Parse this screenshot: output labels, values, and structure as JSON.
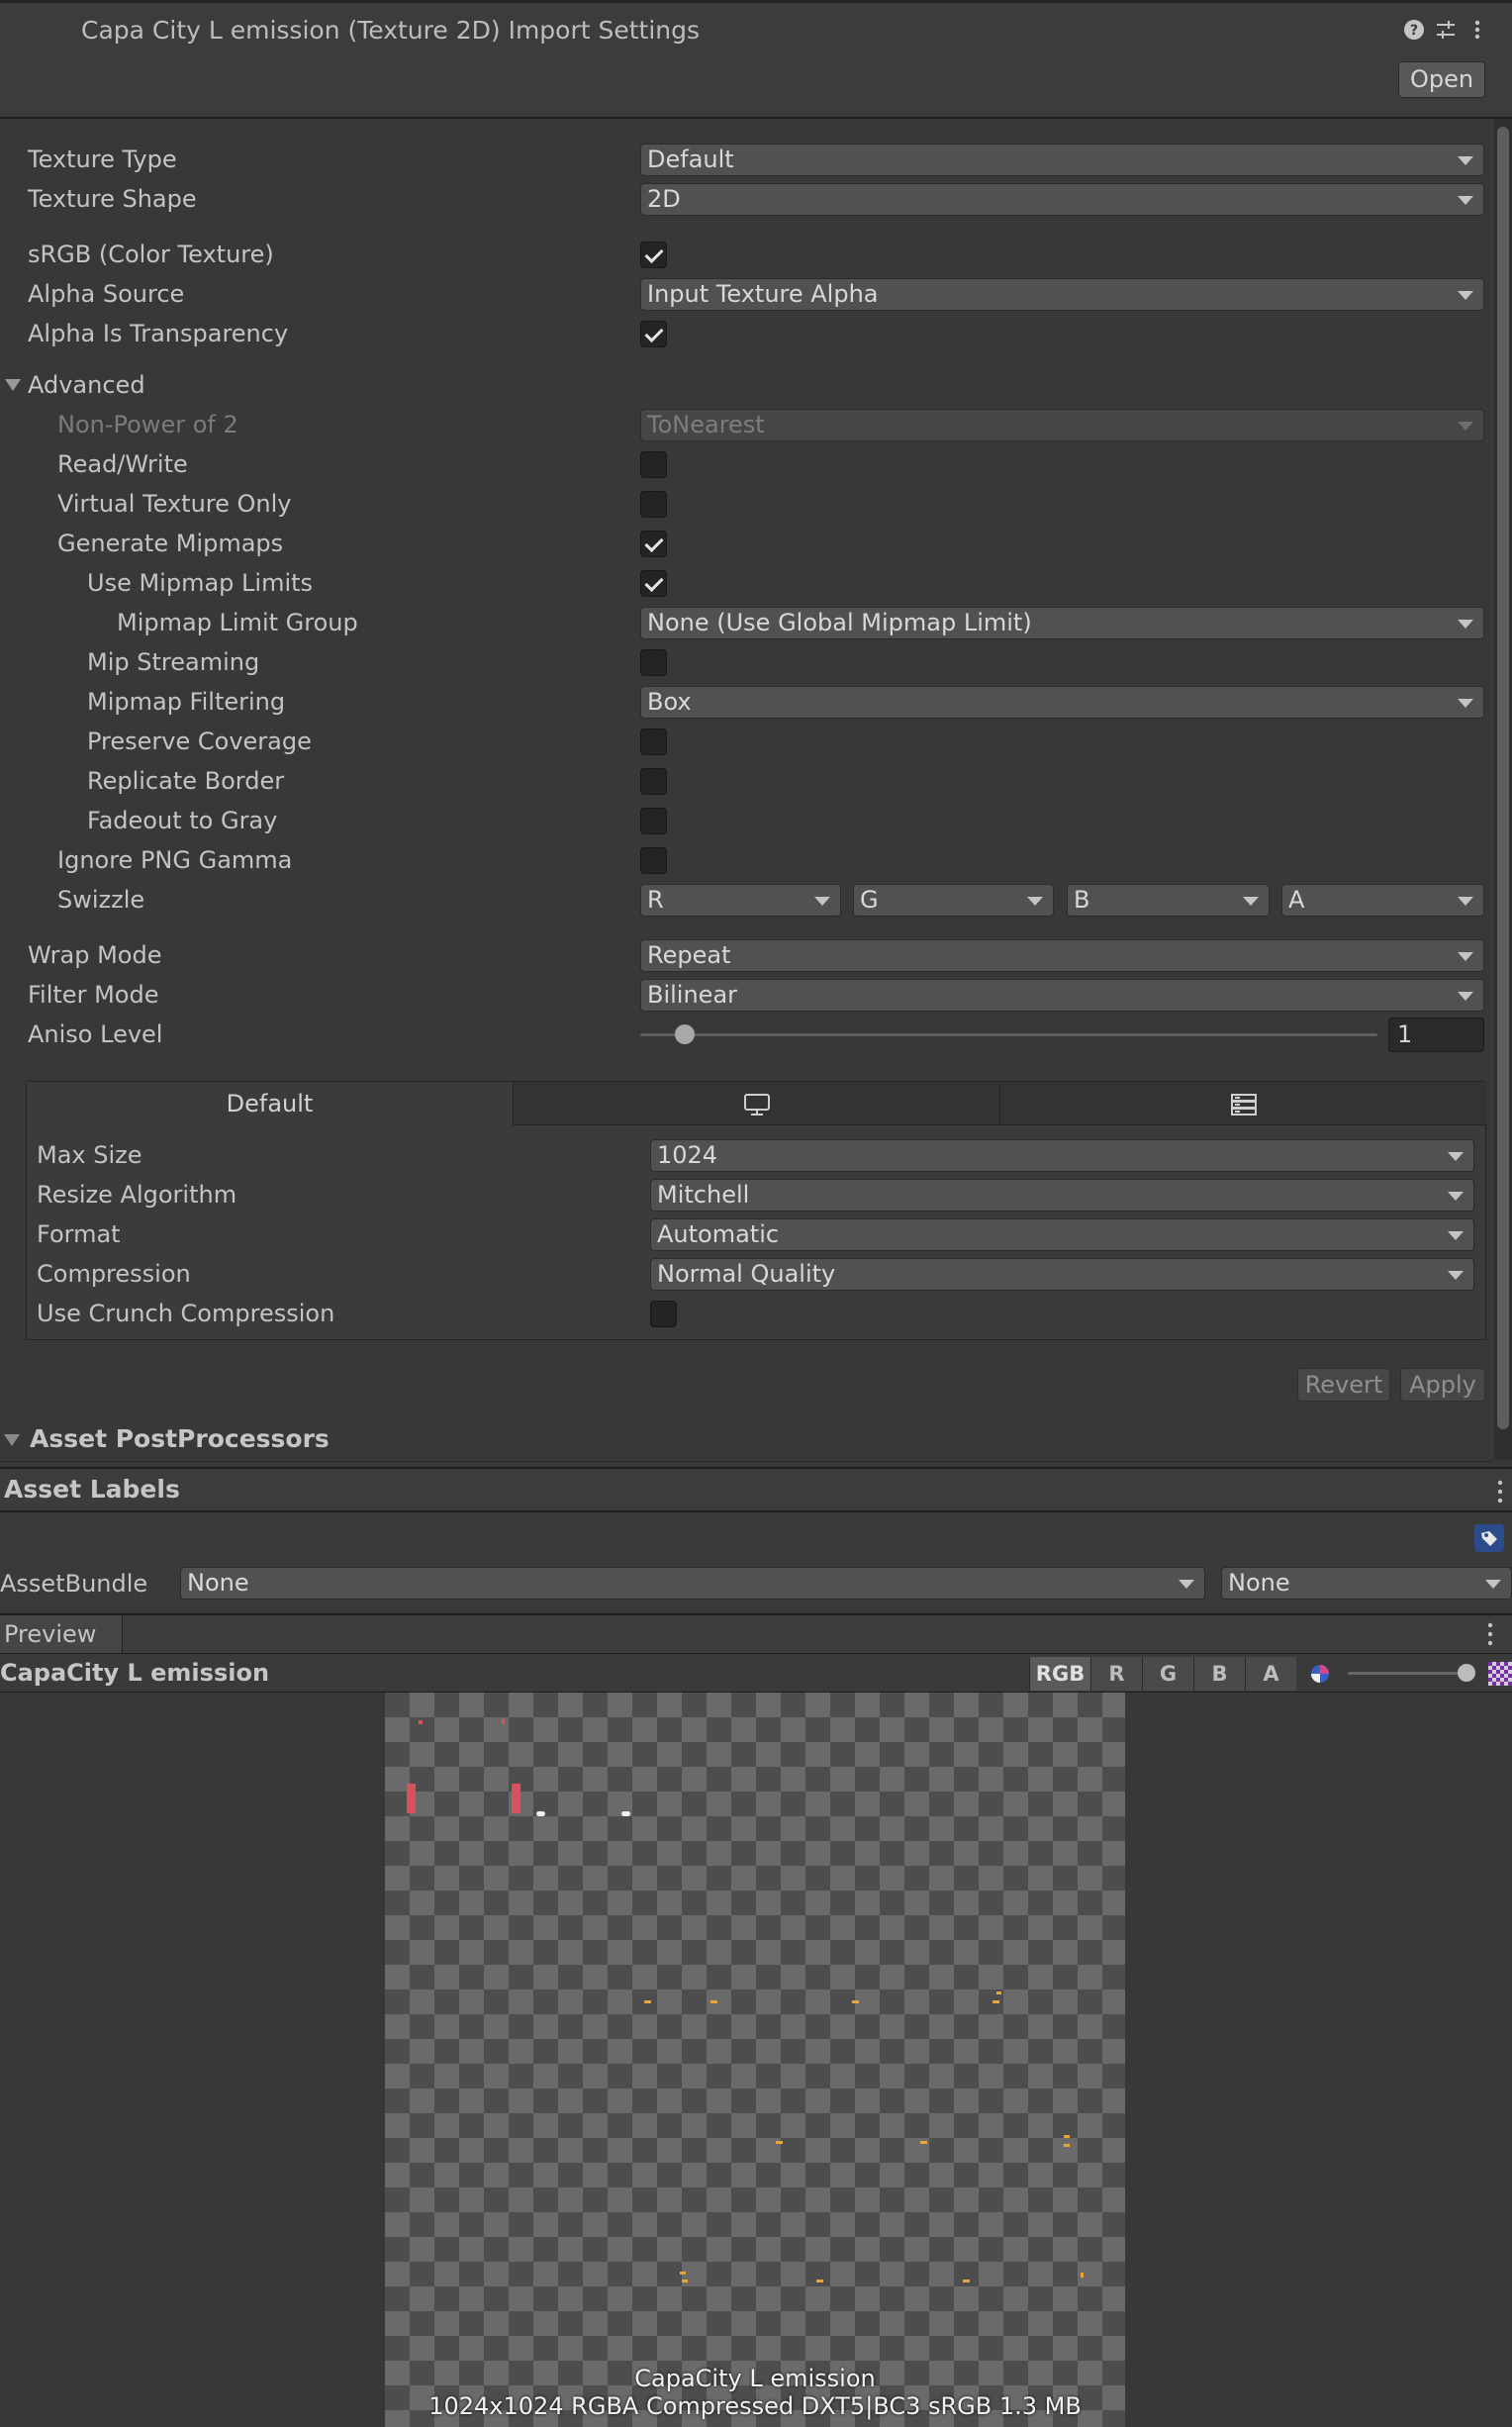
{
  "header": {
    "title": "Capa City L emission (Texture 2D) Import Settings",
    "open_label": "Open",
    "icons": [
      "help-icon",
      "presets-icon",
      "more-icon"
    ]
  },
  "settings": {
    "texture_type": {
      "label": "Texture Type",
      "value": "Default"
    },
    "texture_shape": {
      "label": "Texture Shape",
      "value": "2D"
    },
    "srgb": {
      "label": "sRGB (Color Texture)",
      "checked": true
    },
    "alpha_source": {
      "label": "Alpha Source",
      "value": "Input Texture Alpha"
    },
    "alpha_is_transparency": {
      "label": "Alpha Is Transparency",
      "checked": true
    },
    "advanced": {
      "label": "Advanced",
      "expanded": true
    },
    "non_power_of_2": {
      "label": "Non-Power of 2",
      "value": "ToNearest",
      "disabled": true
    },
    "read_write": {
      "label": "Read/Write",
      "checked": false
    },
    "virtual_texture_only": {
      "label": "Virtual Texture Only",
      "checked": false
    },
    "generate_mipmaps": {
      "label": "Generate Mipmaps",
      "checked": true
    },
    "use_mipmap_limits": {
      "label": "Use Mipmap Limits",
      "checked": true
    },
    "mipmap_limit_group": {
      "label": "Mipmap Limit Group",
      "value": "None (Use Global Mipmap Limit)"
    },
    "mip_streaming": {
      "label": "Mip Streaming",
      "checked": false
    },
    "mipmap_filtering": {
      "label": "Mipmap Filtering",
      "value": "Box"
    },
    "preserve_coverage": {
      "label": "Preserve Coverage",
      "checked": false
    },
    "replicate_border": {
      "label": "Replicate Border",
      "checked": false
    },
    "fadeout_to_gray": {
      "label": "Fadeout to Gray",
      "checked": false
    },
    "ignore_png_gamma": {
      "label": "Ignore PNG Gamma",
      "checked": false
    },
    "swizzle": {
      "label": "Swizzle",
      "values": [
        "R",
        "G",
        "B",
        "A"
      ]
    },
    "wrap_mode": {
      "label": "Wrap Mode",
      "value": "Repeat"
    },
    "filter_mode": {
      "label": "Filter Mode",
      "value": "Bilinear"
    },
    "aniso_level": {
      "label": "Aniso Level",
      "value": "1",
      "fraction": 0.06
    }
  },
  "platform": {
    "tabs": [
      {
        "label": "Default",
        "active": true
      },
      {
        "icon": "monitor-icon"
      },
      {
        "icon": "server-icon"
      }
    ],
    "max_size": {
      "label": "Max Size",
      "value": "1024"
    },
    "resize_algorithm": {
      "label": "Resize Algorithm",
      "value": "Mitchell"
    },
    "format": {
      "label": "Format",
      "value": "Automatic"
    },
    "compression": {
      "label": "Compression",
      "value": "Normal Quality"
    },
    "use_crunch": {
      "label": "Use Crunch Compression",
      "checked": false
    }
  },
  "actions": {
    "revert": "Revert",
    "apply": "Apply"
  },
  "asset_postprocessors": {
    "label": "Asset PostProcessors"
  },
  "asset_labels": {
    "label": "Asset Labels",
    "assetbundle_label": "AssetBundle",
    "assetbundle_value": "None",
    "variant_value": "None"
  },
  "preview": {
    "tab_label": "Preview",
    "asset_name": "CapaCity L emission",
    "channels": [
      "RGB",
      "R",
      "G",
      "B",
      "A"
    ],
    "caption_name": "CapaCity L emission",
    "caption_info": "1024x1024  RGBA Compressed DXT5|BC3 sRGB  1.3 MB",
    "mip_fraction": 1.0
  }
}
